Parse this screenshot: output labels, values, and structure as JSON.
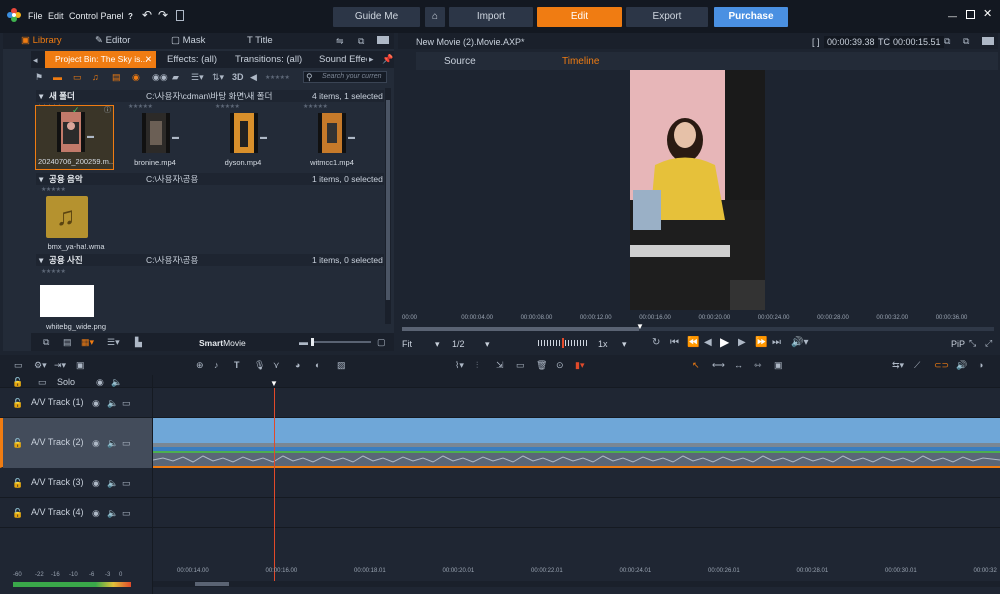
{
  "menu": {
    "file": "File",
    "edit": "Edit",
    "control_panel": "Control Panel",
    "help": "?"
  },
  "top": {
    "guide_me": "Guide Me",
    "import": "Import",
    "edit": "Edit",
    "export": "Export",
    "purchase": "Purchase"
  },
  "library": {
    "tabs": {
      "library": "Library",
      "editor": "Editor",
      "mask": "Mask",
      "title": "Title"
    },
    "bins": [
      "Project Bin: The Sky is...",
      "Effects: (all)",
      "Transitions: (all)",
      "Sound Effect"
    ],
    "search_placeholder": "Search your curren",
    "stars": "★★★★★",
    "folders": [
      {
        "name": "새 폴더",
        "path": "C:\\사용자\\cdman\\바탕 화면\\새 폴더",
        "count": "4 items, 1 selected",
        "items": [
          "20240706_200259.m...",
          "bronine.mp4",
          "dyson.mp4",
          "witmcc1.mp4"
        ]
      },
      {
        "name": "공용 음악",
        "path": "C:\\사용자\\공용",
        "count": "1 items, 0 selected",
        "items": [
          "bmx_ya-ha!.wma"
        ]
      },
      {
        "name": "공용 사진",
        "path": "C:\\사용자\\공용",
        "count": "1 items, 0 selected",
        "items": [
          "whitebg_wide.png"
        ]
      }
    ],
    "smartmovie": {
      "bold": "Smart",
      "normal": "Movie"
    }
  },
  "preview": {
    "title": "New Movie (2).Movie.AXP*",
    "duration": "00:00:39.38",
    "tc_label": "TC",
    "timecode": "00:00:15.51",
    "tabs": [
      "Source",
      "Timeline"
    ],
    "ruler": [
      "00:00",
      "00:00:04.00",
      "00:00:08.00",
      "00:00:12.00",
      "00:00:16.00",
      "00:00:20.00",
      "00:00:24.00",
      "00:00:28.00",
      "00:00:32.00",
      "00:00:36.00"
    ],
    "fit": "Fit",
    "ratio": "1/2",
    "speed": "1x",
    "pip": "PiP"
  },
  "timeline": {
    "solo": "Solo",
    "tracks": [
      "A/V Track (1)",
      "A/V Track (2)",
      "A/V Track (3)",
      "A/V Track (4)"
    ],
    "ruler": [
      "00:00:14.00",
      "00:00:16.00",
      "00:00:18.01",
      "00:00:20.01",
      "00:00:22.01",
      "00:00:24.01",
      "00:00:26.01",
      "00:00:28.01",
      "00:00:30.01",
      "00:00:32"
    ],
    "meter": [
      "-60",
      "-22",
      "-16",
      "-10",
      "-6",
      "-3",
      "0"
    ]
  },
  "colors": {
    "accent": "#f07c12",
    "purchase": "#4a90e2",
    "clip": "#6fa7d8",
    "playhead": "#e14a2a"
  }
}
